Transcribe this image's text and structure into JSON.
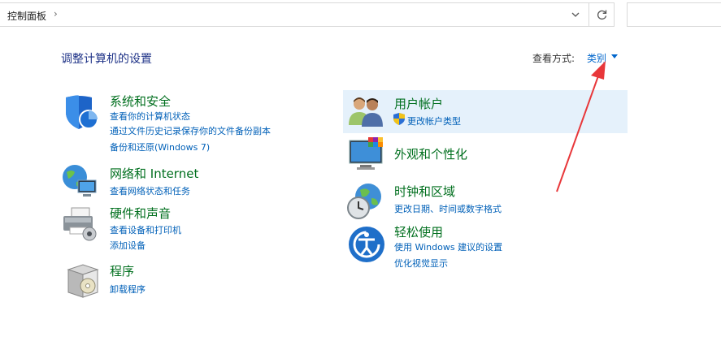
{
  "address_bar": {
    "breadcrumb": "控制面板",
    "separator": "›"
  },
  "header": {
    "title": "调整计算机的设置",
    "view_by_label": "查看方式:",
    "view_by_value": "类别"
  },
  "left": [
    {
      "title": "系统和安全",
      "icon": "shield-icon",
      "links": [
        "查看你的计算机状态",
        "通过文件历史记录保存你的文件备份副本",
        "备份和还原(Windows 7)"
      ]
    },
    {
      "title": "网络和 Internet",
      "icon": "network-globe-icon",
      "links": [
        "查看网络状态和任务"
      ]
    },
    {
      "title": "硬件和声音",
      "icon": "printer-icon",
      "links": [
        "查看设备和打印机",
        "添加设备"
      ]
    },
    {
      "title": "程序",
      "icon": "program-disc-icon",
      "links": [
        "卸载程序"
      ]
    }
  ],
  "right": [
    {
      "title": "用户帐户",
      "icon": "users-icon",
      "links": [
        "更改帐户类型"
      ]
    },
    {
      "title": "外观和个性化",
      "icon": "monitor-palette-icon",
      "links": []
    },
    {
      "title": "时钟和区域",
      "icon": "clock-globe-icon",
      "links": [
        "更改日期、时间或数字格式"
      ]
    },
    {
      "title": "轻松使用",
      "icon": "ease-of-access-icon",
      "links": [
        "使用 Windows 建议的设置",
        "优化视觉显示"
      ]
    }
  ],
  "colors": {
    "title_green": "#006f1e",
    "link_blue": "#0060b8",
    "highlight": "#e5f1fb",
    "annotation_red": "#e8373a"
  }
}
